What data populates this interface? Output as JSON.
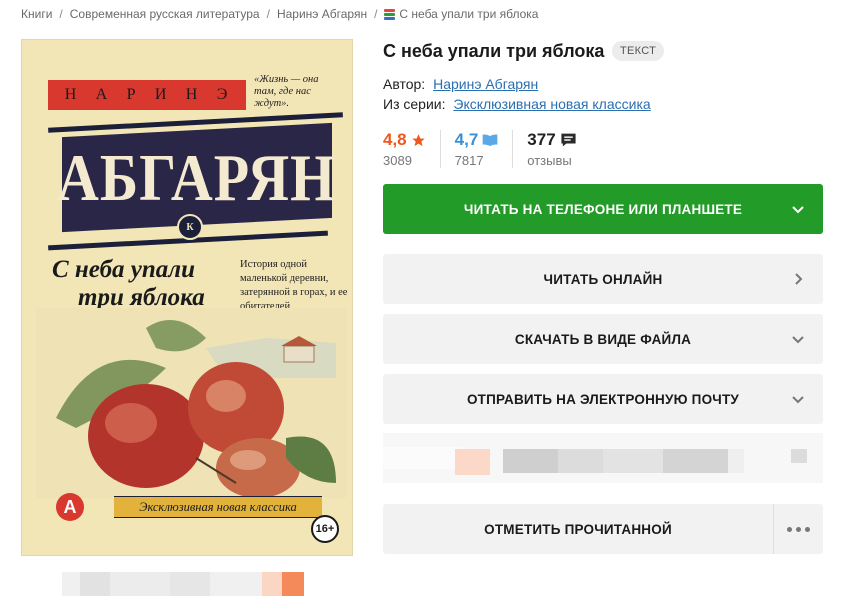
{
  "breadcrumb": {
    "items": [
      "Книги",
      "Современная русская литература",
      "Наринэ Абгарян"
    ],
    "current": "С неба упали три яблока"
  },
  "cover": {
    "author_letters": [
      "Н",
      "А",
      "Р",
      "И",
      "Н",
      "Э"
    ],
    "quote": "«Жизнь — она там, где нас ждут».",
    "author_big": "АБГАРЯН",
    "emblem": "К",
    "title_line1": "С неба упали",
    "title_line2": "три яблока",
    "blurb": "История одной маленькой деревни, затерянной в горах, и ее обитателей",
    "series": "Эксклюзивная новая классика",
    "publisher_logo": "А",
    "age_rating": "16+"
  },
  "book": {
    "title": "С неба упали три яблока",
    "type_badge": "ТЕКСТ",
    "author_label": "Автор:",
    "author_name": "Наринэ Абгарян",
    "series_label": "Из серии:",
    "series_name": "Эксклюзивная новая классика"
  },
  "ratings": {
    "litres": {
      "value": "4,8",
      "count": "3089",
      "color": "#f0561d"
    },
    "livelib": {
      "value": "4,7",
      "count": "7817",
      "color": "#3a8fd6"
    },
    "reviews": {
      "value": "377",
      "count": "отзывы"
    }
  },
  "actions": {
    "read_on_phone": "ЧИТАТЬ НА ТЕЛЕФОНЕ ИЛИ ПЛАНШЕТЕ",
    "read_online": "ЧИТАТЬ ОНЛАЙН",
    "download": "СКАЧАТЬ В ВИДЕ ФАЙЛА",
    "send_email": "ОТПРАВИТЬ НА ЭЛЕКТРОННУЮ ПОЧТУ",
    "mark_read": "ОТМЕТИТЬ ПРОЧИТАННОЙ"
  },
  "colors": {
    "primary_green": "#239b29",
    "link_blue": "#2a6fb0",
    "button_gray": "#f2f2f2"
  }
}
